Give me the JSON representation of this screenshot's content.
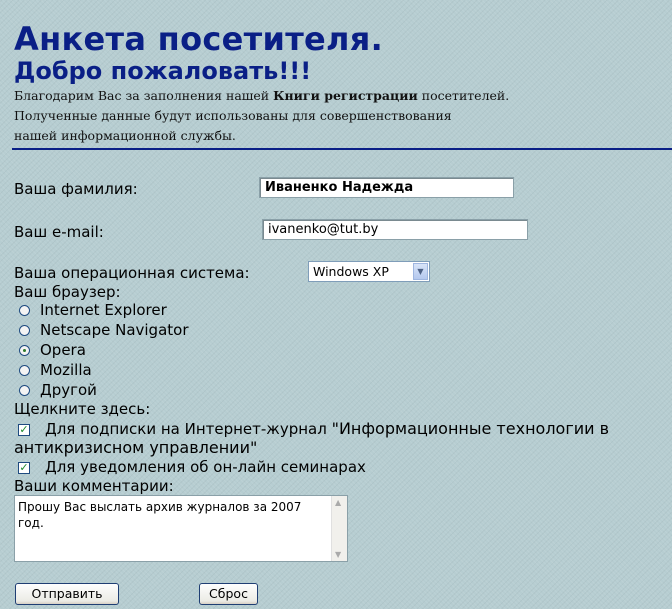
{
  "header": {
    "title": "Анкета посетителя.",
    "welcome": "Добро пожаловать!!!",
    "intro": {
      "line1_before": "Благодарим Вас за заполнения нашей ",
      "line1_bold": "Книги регистрации",
      "line1_after": " посетителей.",
      "line2": "Полученные данные будут использованы для совершенствования",
      "line3": "нашей информационной службы."
    }
  },
  "form": {
    "surname": {
      "label": "Ваша фамилия:",
      "value": "Иваненко Надежда"
    },
    "email": {
      "label": "Ваш e-mail:",
      "value": "ivanenko@tut.by"
    },
    "os": {
      "label": "Ваша операционная система:",
      "selected": "Windows XP"
    },
    "browser": {
      "label": "Ваш браузер:",
      "options": [
        {
          "label": "Internet Explorer",
          "checked": false
        },
        {
          "label": "Netscape Navigator",
          "checked": false
        },
        {
          "label": "Opera",
          "checked": true
        },
        {
          "label": "Mozilla",
          "checked": false
        },
        {
          "label": "Другой",
          "checked": false
        }
      ]
    },
    "click_here": {
      "label": "Щелкните здесь:",
      "subscribe": {
        "text": "Для подписки на Интернет-журнал ",
        "quote_line1": "\"Информационные технологии в",
        "quote_line2": "антикризисном управлении\"",
        "checked": true
      },
      "notify": {
        "text": "Для уведомления об он-лайн семинарах",
        "checked": true
      }
    },
    "comments": {
      "label": "Ваши комментарии:",
      "value": "Прошу Вас выслать архив журналов за 2007 год."
    },
    "buttons": {
      "submit": "Отправить",
      "reset": "Сброс"
    }
  },
  "colors": {
    "heading": "#0a1f86",
    "background": "#b6cdd1",
    "rule": "#0a1f86"
  }
}
